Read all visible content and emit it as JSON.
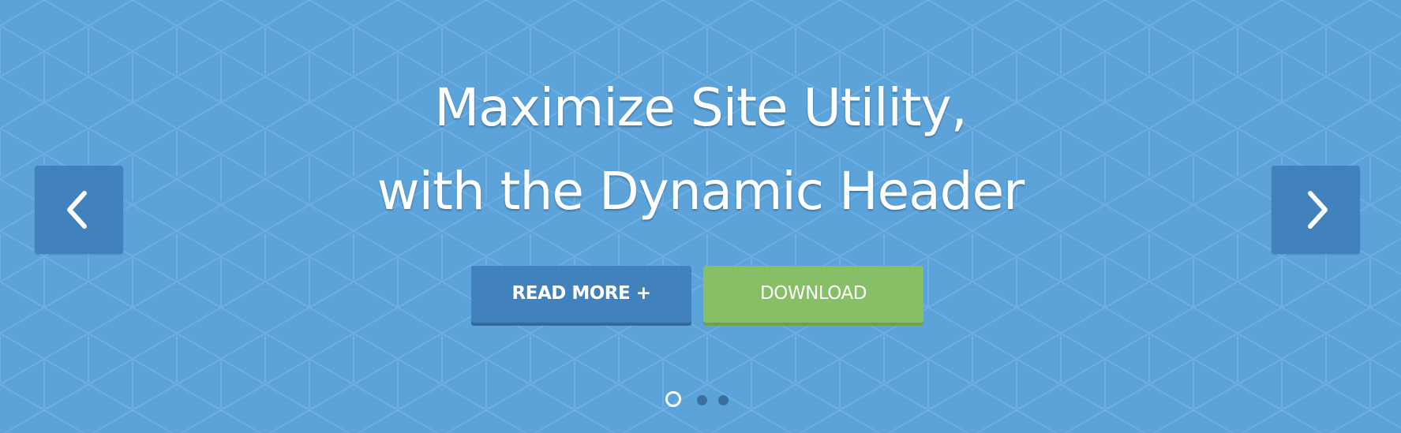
{
  "hero": {
    "background_color": "#5ba3d9",
    "headline_line1": "Maximize Site Utility,",
    "headline_line2": "with the Dynamic Header",
    "text_color": "#ffffff"
  },
  "navigation": {
    "prev_icon": "chevron-left-icon",
    "next_icon": "chevron-right-icon",
    "arrow_bg_color": "#4282bc"
  },
  "buttons": {
    "read_more_label": "READ MORE +",
    "read_more_color": "#4282bc",
    "download_label": "DOWNLOAD",
    "download_color": "#87bf66"
  },
  "pagination": {
    "total_slides": 3,
    "active_slide": 1
  }
}
